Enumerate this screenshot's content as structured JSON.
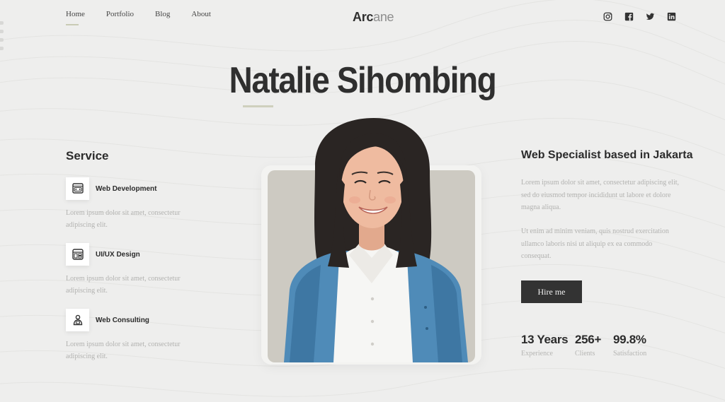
{
  "nav": {
    "items": [
      {
        "label": "Home",
        "active": true
      },
      {
        "label": "Portfolio",
        "active": false
      },
      {
        "label": "Blog",
        "active": false
      },
      {
        "label": "About",
        "active": false
      }
    ]
  },
  "logo": {
    "part1": "Arc",
    "part2": "ane"
  },
  "socials": [
    "instagram-icon",
    "facebook-icon",
    "twitter-icon",
    "linkedin-icon"
  ],
  "hero": {
    "name": "Natalie Sihombing"
  },
  "service": {
    "heading": "Service",
    "items": [
      {
        "icon": "code-window-icon",
        "name": "Web Development",
        "desc": "Lorem ipsum dolor sit amet, consectetur adipiscing elit."
      },
      {
        "icon": "layout-grid-icon",
        "name": "UI/UX Design",
        "desc": "Lorem ipsum dolor sit amet, consectetur adipiscing elit."
      },
      {
        "icon": "user-consult-icon",
        "name": "Web Consulting",
        "desc": "Lorem ipsum dolor sit amet, consectetur adipiscing elit."
      }
    ]
  },
  "about": {
    "heading": "Web Specialist based in Jakarta",
    "para1": "Lorem ipsum dolor sit amet, consectetur adipiscing elit, sed do eiusmod tempor incididunt ut labore et dolore magna aliqua.",
    "para2": "Ut enim ad minim veniam, quis nostrud exercitation ullamco laboris nisi ut aliquip ex ea commodo consequat.",
    "cta": "Hire me"
  },
  "stats": [
    {
      "value": "13 Years",
      "label": "Experience"
    },
    {
      "value": "256+",
      "label": "Clients"
    },
    {
      "value": "99.8%",
      "label": "Satisfaction"
    }
  ],
  "colors": {
    "background": "#eeeeed",
    "dark": "#333333",
    "accent": "#cfd0bd",
    "muted_text": "#b2b2b0"
  }
}
